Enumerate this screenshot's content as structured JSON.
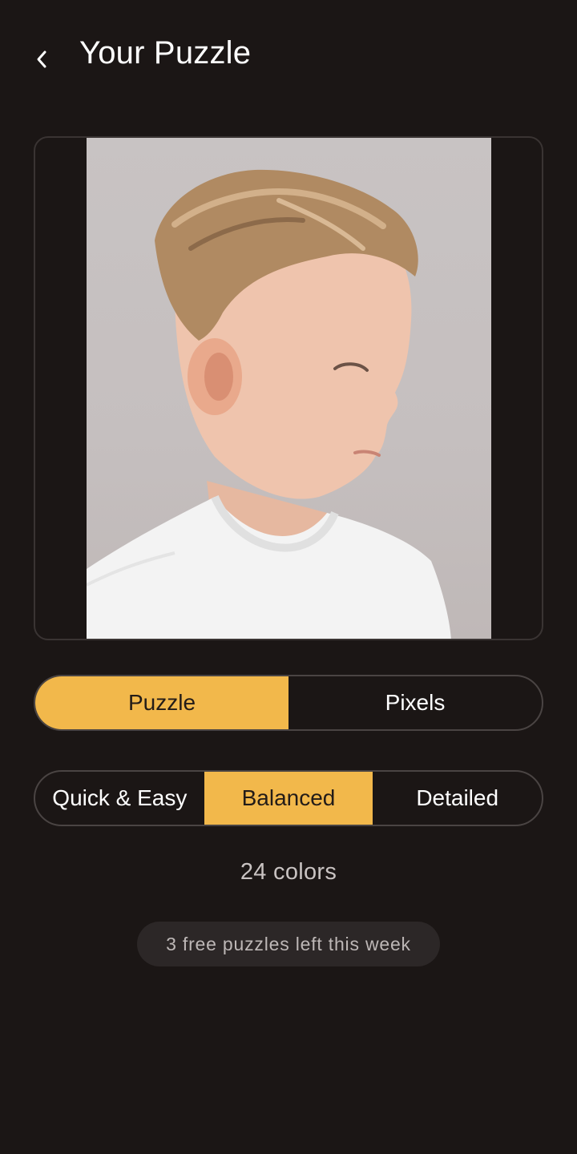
{
  "header": {
    "back_icon": "chevron-left-icon",
    "title": "Your Puzzle"
  },
  "preview": {
    "image_subject": "portrait-photo"
  },
  "mode_toggle": {
    "options": [
      "Puzzle",
      "Pixels"
    ],
    "selected": "Puzzle"
  },
  "detail_toggle": {
    "options": [
      "Quick & Easy",
      "Balanced",
      "Detailed"
    ],
    "selected": "Balanced"
  },
  "colors_count": "24 colors",
  "free_puzzles_note": "3 free puzzles left this week",
  "theme": {
    "background": "#1b1615",
    "accent": "#f2b84b",
    "border": "#4a4443",
    "pill_bg": "#2c2727"
  }
}
